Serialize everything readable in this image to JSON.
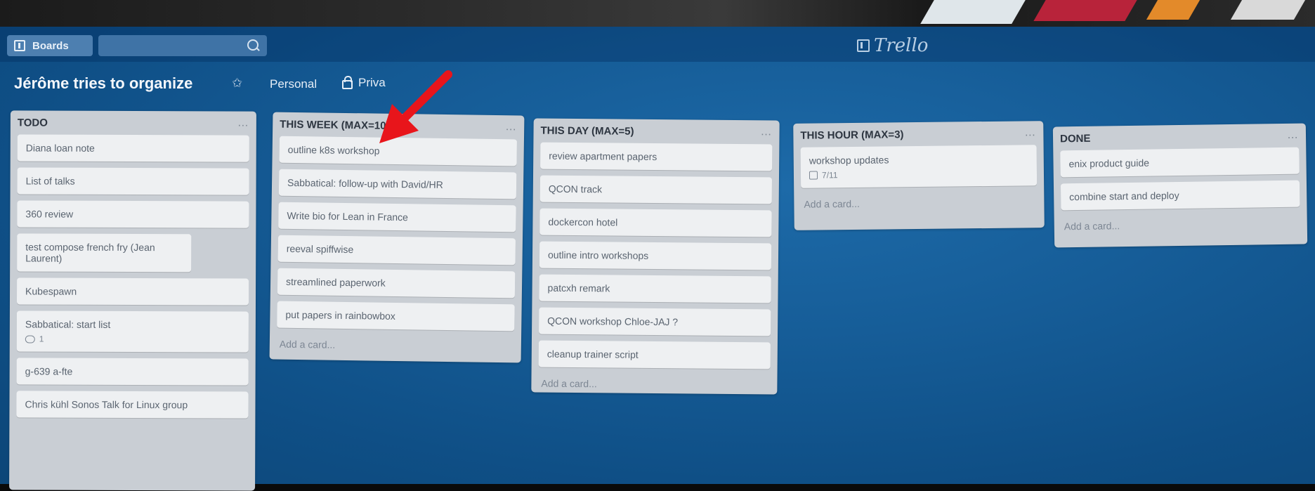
{
  "header": {
    "boards_label": "Boards",
    "logo_text": "Trello"
  },
  "board": {
    "title": "Jérôme tries to organize",
    "team": "Personal",
    "visibility": "Priva"
  },
  "lists": [
    {
      "title": "TODO",
      "cards": [
        {
          "label": "Diana loan note"
        },
        {
          "label": "List of talks"
        },
        {
          "label": "360 review"
        },
        {
          "label": "test compose french fry (Jean Laurent)"
        },
        {
          "label": "Kubespawn"
        },
        {
          "label": "Sabbatical: start list",
          "comments": "1"
        },
        {
          "label": "g-639 a-fte"
        },
        {
          "label": "Chris kühl Sonos Talk for Linux group"
        }
      ]
    },
    {
      "title": "THIS WEEK (MAX=10)",
      "cards": [
        {
          "label": "outline k8s workshop"
        },
        {
          "label": "Sabbatical: follow-up with David/HR"
        },
        {
          "label": "Write bio for Lean in France"
        },
        {
          "label": "reeval spiffwise"
        },
        {
          "label": "streamlined paperwork"
        },
        {
          "label": "put papers in rainbowbox"
        }
      ],
      "add_card": "Add a card..."
    },
    {
      "title": "THIS DAY (MAX=5)",
      "cards": [
        {
          "label": "review apartment papers"
        },
        {
          "label": "QCON track"
        },
        {
          "label": "dockercon hotel"
        },
        {
          "label": "outline intro workshops"
        },
        {
          "label": "patcxh remark"
        },
        {
          "label": "QCON workshop Chloe-JAJ ?"
        },
        {
          "label": "cleanup trainer script"
        }
      ],
      "add_card": "Add a card..."
    },
    {
      "title": "THIS HOUR (MAX=3)",
      "cards": [
        {
          "label": "workshop updates",
          "checklist": "7/11"
        }
      ],
      "add_card": "Add a card..."
    },
    {
      "title": "DONE",
      "cards": [
        {
          "label": "enix product guide"
        },
        {
          "label": "combine start and deploy"
        }
      ],
      "add_card": "Add a card..."
    }
  ],
  "colors": {
    "board_background": "#165d98",
    "list_background": "#c9ced4",
    "card_background": "#eef0f2",
    "annotation_arrow": "#e8151b"
  },
  "icons": [
    "boards-icon",
    "search-icon",
    "trello-logo-icon",
    "star-icon",
    "lock-icon",
    "menu-ellipsis-icon",
    "comment-icon",
    "checklist-icon",
    "red-arrow-annotation"
  ]
}
